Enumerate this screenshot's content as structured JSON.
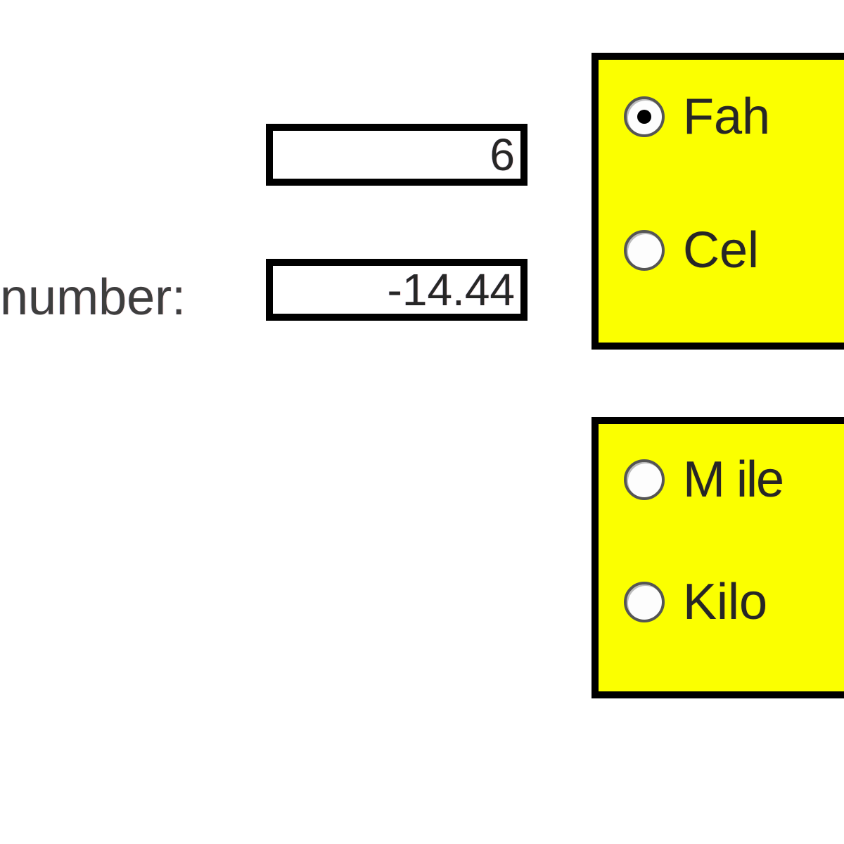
{
  "labels": {
    "number": "number:"
  },
  "fields": {
    "input_value": "6",
    "output_value": "-14.44"
  },
  "panels": {
    "temperature": {
      "options": {
        "fahrenheit": {
          "label_visible": "Fah",
          "selected": true
        },
        "celsius": {
          "label_visible": "Cel",
          "selected": false
        }
      }
    },
    "distance": {
      "options": {
        "miles": {
          "label_visible": "M ile",
          "selected": false
        },
        "kilometers": {
          "label_visible": "Kilo",
          "selected": false
        }
      }
    }
  }
}
